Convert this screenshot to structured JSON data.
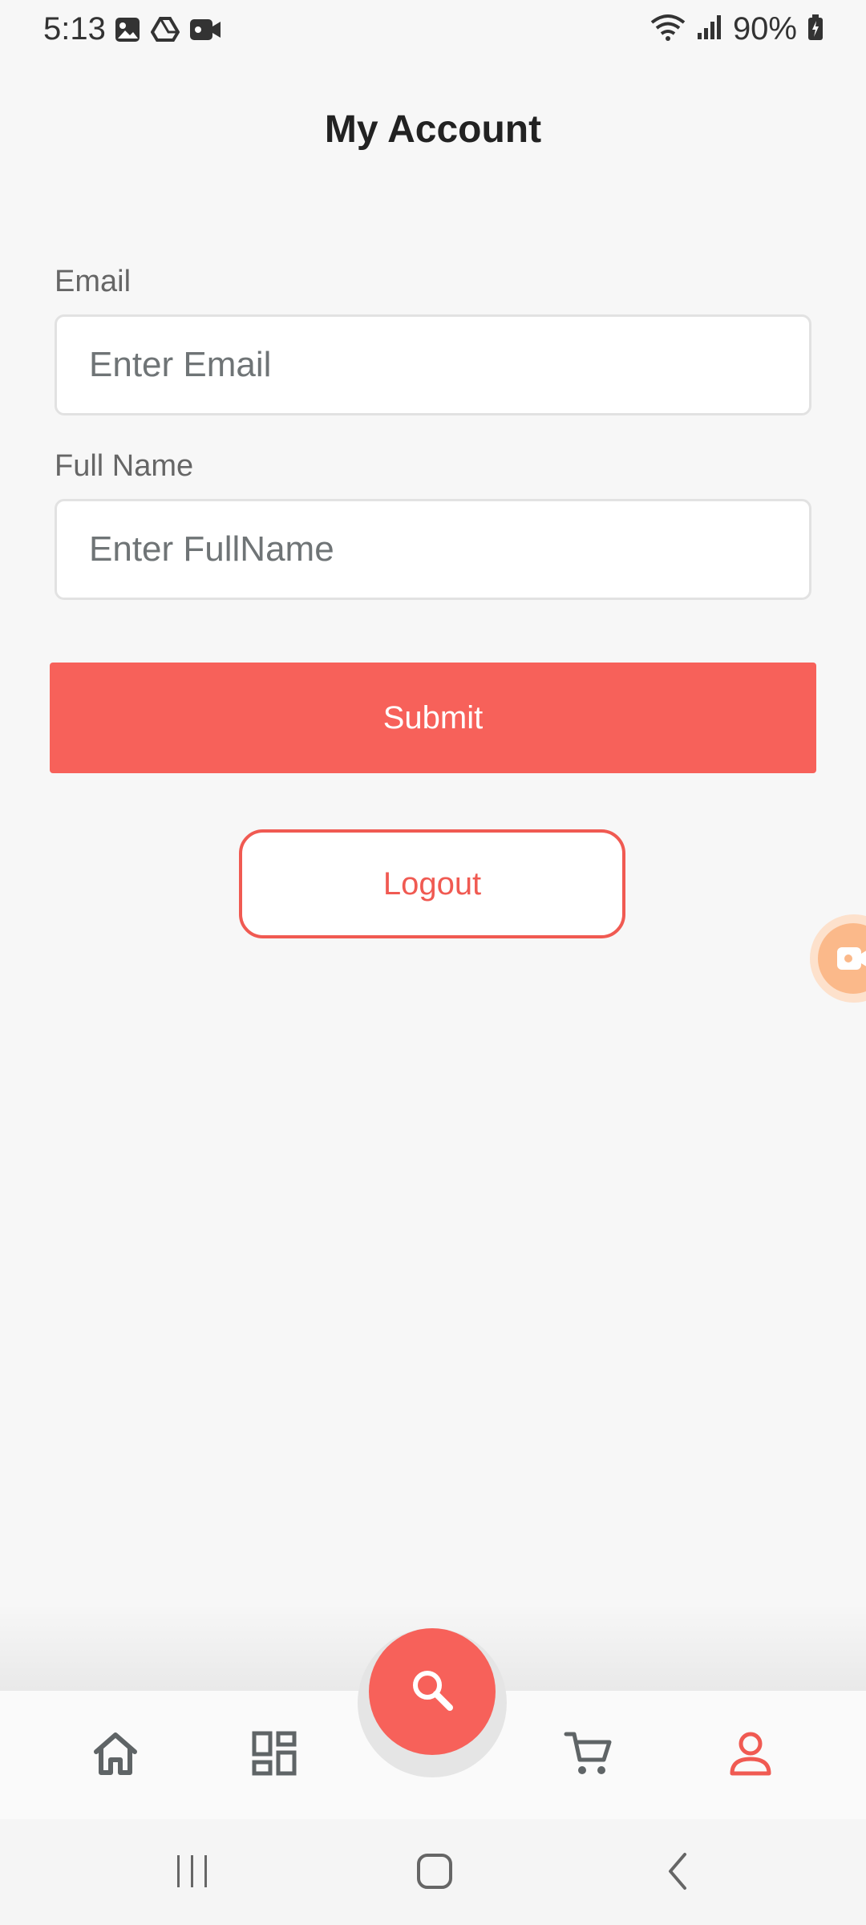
{
  "status_bar": {
    "time": "5:13",
    "battery": "90%",
    "left_icons": [
      "image-icon",
      "drive-icon",
      "video-camera-icon"
    ],
    "right_icons": [
      "wifi-icon",
      "signal-icon",
      "battery-charging-icon"
    ]
  },
  "header": {
    "title": "My Account"
  },
  "form": {
    "email": {
      "label": "Email",
      "placeholder": "Enter Email",
      "value": ""
    },
    "full_name": {
      "label": "Full Name",
      "placeholder": "Enter FullName",
      "value": ""
    },
    "submit_label": "Submit",
    "logout_label": "Logout"
  },
  "bottom_nav": {
    "items": [
      {
        "icon": "home-icon",
        "active": false
      },
      {
        "icon": "categories-icon",
        "active": false
      },
      {
        "icon": "search-icon",
        "active": false
      },
      {
        "icon": "cart-icon",
        "active": false
      },
      {
        "icon": "account-icon",
        "active": true
      }
    ]
  },
  "system_nav": [
    "recent-apps-icon",
    "home-button-icon",
    "back-icon"
  ],
  "colors": {
    "accent": "#f7615a",
    "background": "#f7f7f7",
    "inactive_icon": "#5f6466",
    "widget": "#fbb98a"
  }
}
